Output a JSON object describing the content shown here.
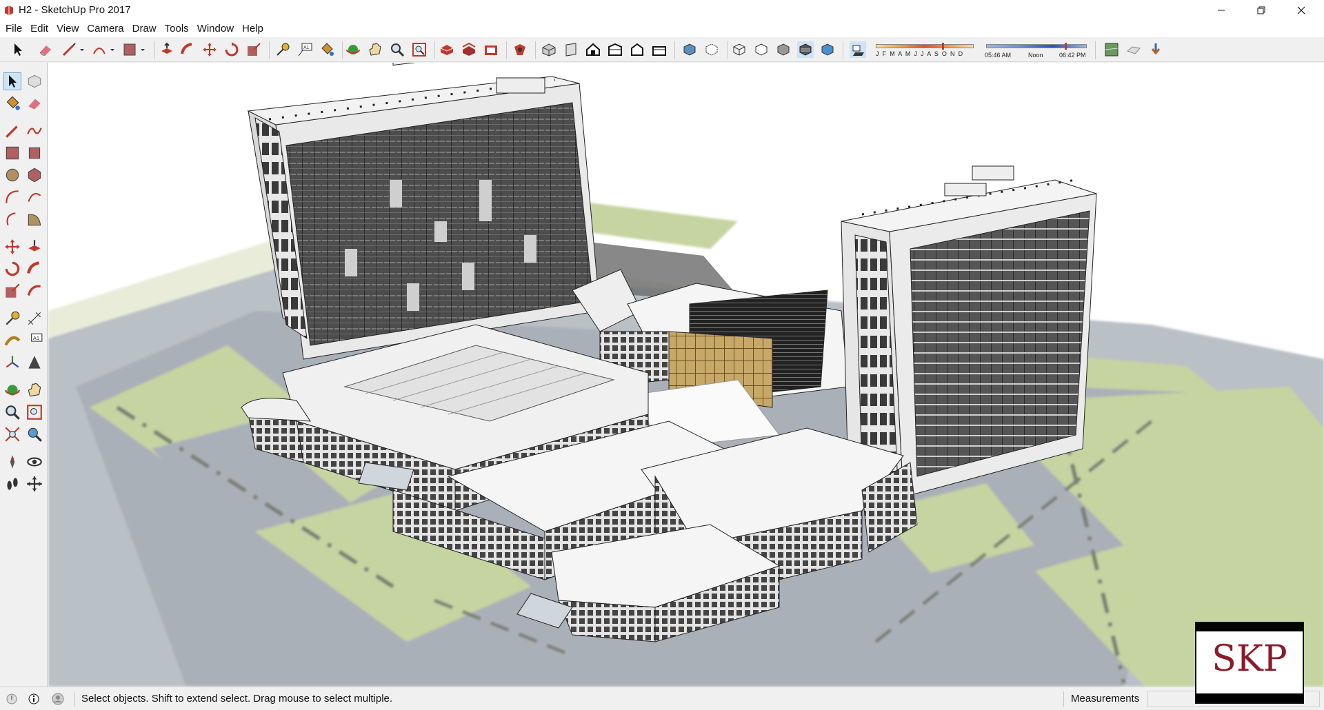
{
  "window": {
    "title": "H2 - SketchUp Pro 2017"
  },
  "menu": [
    "File",
    "Edit",
    "View",
    "Camera",
    "Draw",
    "Tools",
    "Window",
    "Help"
  ],
  "shadow": {
    "months": "J F M A M J J A S O N D",
    "time_start": "05:46 AM",
    "time_mid": "Noon",
    "time_end": "06:42 PM"
  },
  "status": {
    "message": "Select objects. Shift to extend select. Drag mouse to select multiple.",
    "measurements_label": "Measurements",
    "measurements_value": ""
  },
  "badge": {
    "text": "SKP"
  },
  "colors": {
    "accent": "#c0392b",
    "ground": "#c5d4a0",
    "road": "#aab0b8"
  }
}
